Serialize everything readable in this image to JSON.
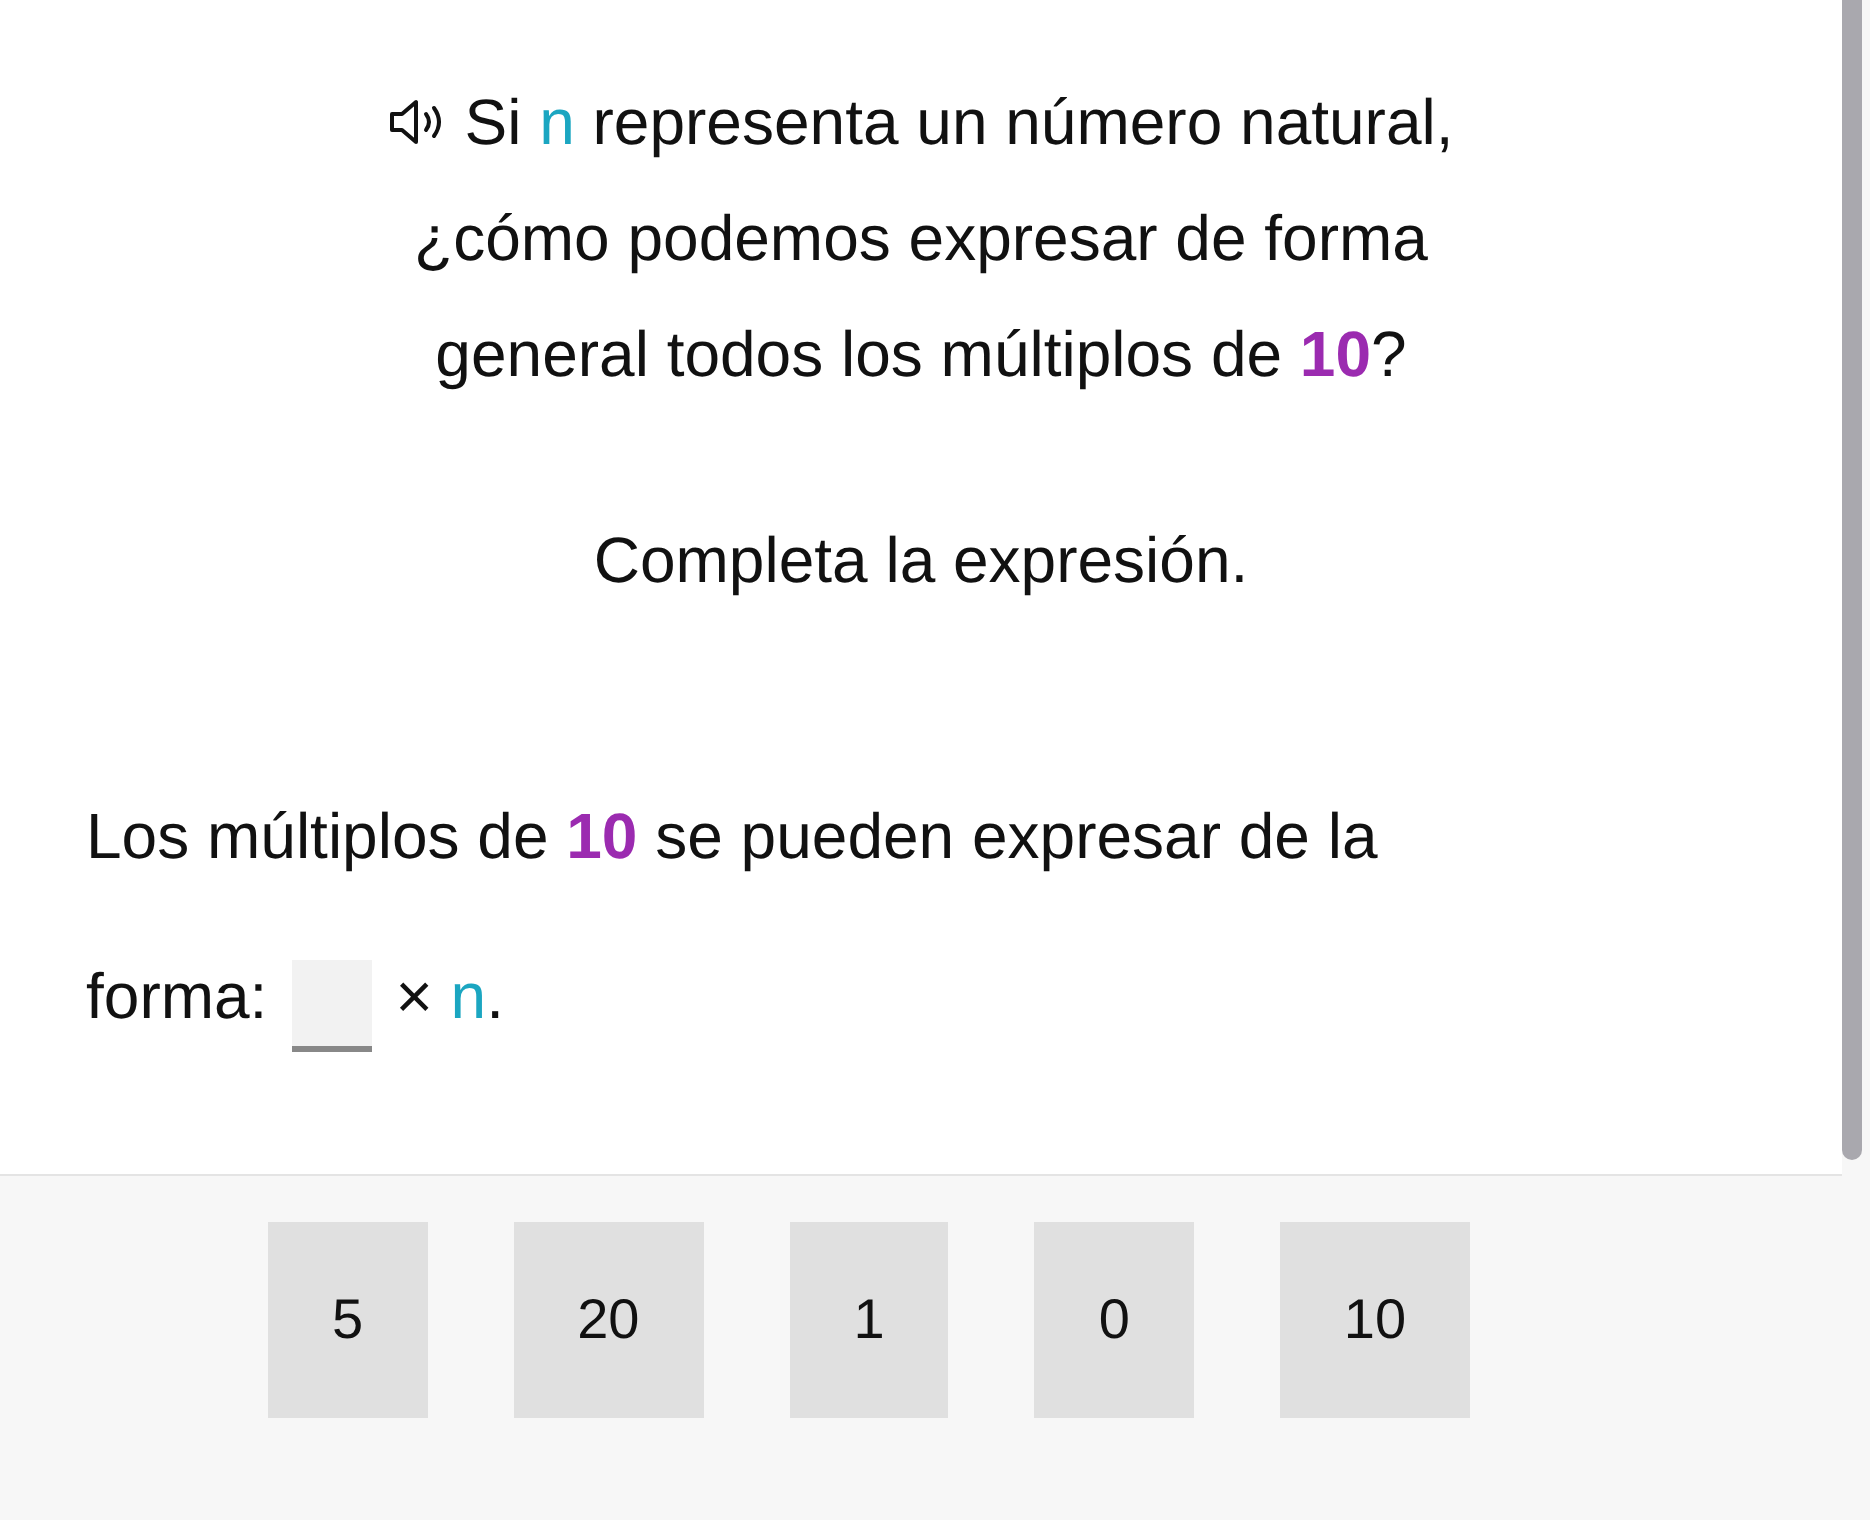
{
  "question_lines": [
    [
      {
        "text": "Si ",
        "kind": "plain"
      },
      {
        "text": "n",
        "kind": "variable"
      },
      {
        "text": " representa un número natural,",
        "kind": "plain"
      }
    ],
    [
      {
        "text": "¿cómo podemos expresar de forma",
        "kind": "plain"
      }
    ],
    [
      {
        "text": "general todos los múltiplos de ",
        "kind": "plain"
      },
      {
        "text": "10",
        "kind": "number"
      },
      {
        "text": "?",
        "kind": "plain"
      }
    ]
  ],
  "instruction": "Completa la expresión.",
  "statement": [
    {
      "text": "Los múltiplos de ",
      "kind": "plain"
    },
    {
      "text": "10",
      "kind": "number"
    },
    {
      "text": " se pueden expresar de la",
      "kind": "plain"
    }
  ],
  "statement_end": "forma:",
  "expression_tail": [
    {
      "text": "× ",
      "kind": "plain"
    },
    {
      "text": "n",
      "kind": "variable"
    },
    {
      "text": ".",
      "kind": "plain"
    }
  ],
  "options": [
    "5",
    "20",
    "1",
    "0",
    "10"
  ]
}
